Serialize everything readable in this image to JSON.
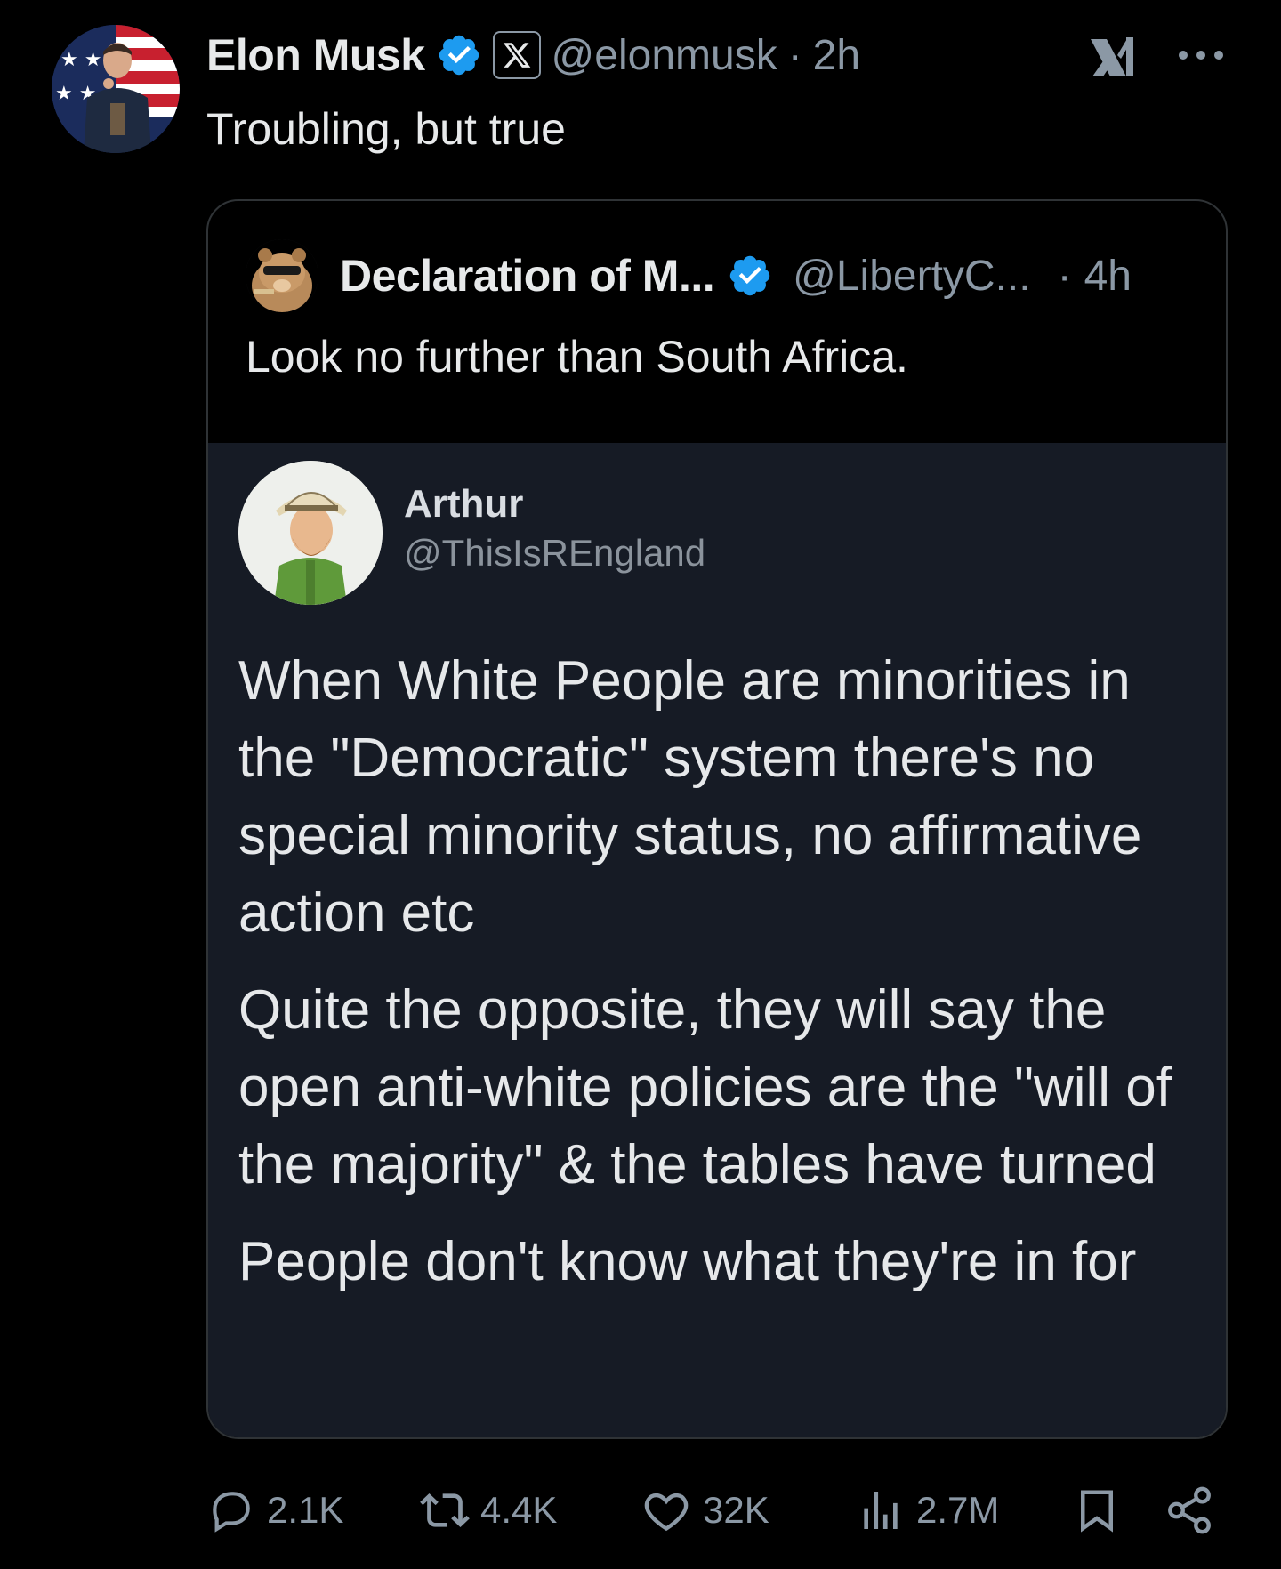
{
  "author": {
    "name": "Elon Musk",
    "handle": "@elonmusk",
    "separator": "·",
    "time": "2h"
  },
  "post": {
    "text": "Troubling, but true"
  },
  "quoted": {
    "name": "Declaration of M...",
    "handle": "@LibertyC...",
    "separator": "·",
    "time": "4h",
    "text": "Look no further than South Africa.",
    "image": {
      "name": "Arthur",
      "handle": "@ThisIsREngland",
      "paragraphs": [
        "When White People are minorities in the \"Democratic\" system there's no special minority status, no affirmative action etc",
        "Quite the opposite, they will say the open anti-white policies are the \"will of the majority\" & the tables have turned",
        "People don't know what they're in for"
      ]
    }
  },
  "actions": {
    "replies": "2.1K",
    "reposts": "4.4K",
    "likes": "32K",
    "views": "2.7M"
  },
  "colors": {
    "background": "#000000",
    "text": "#e7e9ea",
    "muted": "#8b98a5",
    "verified": "#1d9bf0",
    "border": "#2f3336"
  }
}
